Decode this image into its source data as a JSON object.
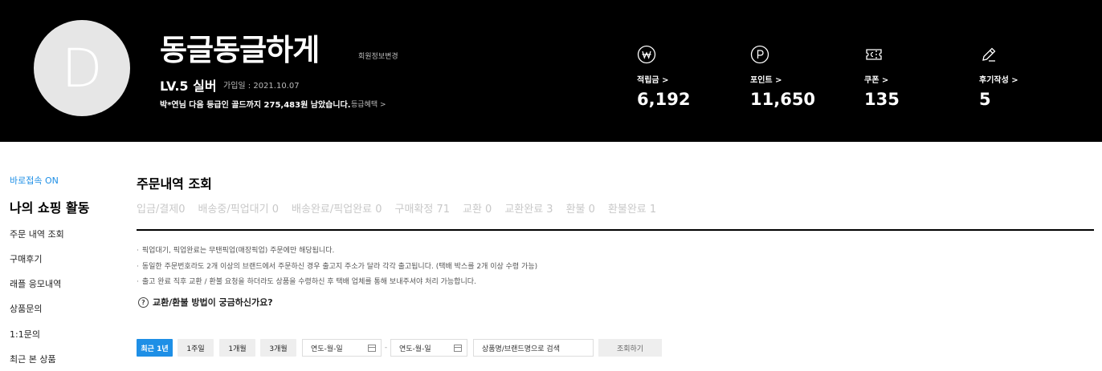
{
  "profile": {
    "avatar_letter": "D",
    "nickname": "동글동글하게",
    "edit_label": "회원정보변경",
    "level": "LV.5 실버",
    "join_date": "가입일 : 2021.10.07",
    "grade_message": "박*연님 다음 등급인 골드까지 275,483원 남았습니다.",
    "grade_benefit_link": "등급혜택 >"
  },
  "stats": [
    {
      "icon": "won-coin-icon",
      "label": "적립금 >",
      "value": "6,192"
    },
    {
      "icon": "point-coin-icon",
      "label": "포인트 >",
      "value": "11,650"
    },
    {
      "icon": "coupon-ticket-icon",
      "label": "쿠폰 >",
      "value": "135"
    },
    {
      "icon": "pencil-icon",
      "label": "후기작성 >",
      "value": "5"
    }
  ],
  "sidebar": {
    "quick_access": "바로접속 ON",
    "title": "나의 쇼핑 활동",
    "items": [
      "주문 내역 조회",
      "구매후기",
      "래플 응모내역",
      "상품문의",
      "1:1문의",
      "최근 본 상품"
    ]
  },
  "main": {
    "title": "주문내역 조회",
    "status_tabs": [
      "입금/결제0",
      "배송중/픽업대기 0",
      "배송완료/픽업완료 0",
      "구매확정 71",
      "교환 0",
      "교환완료 3",
      "환불 0",
      "환불완료 1"
    ],
    "notes": [
      "픽업대기, 픽업완료는 무탠픽업(매장픽업) 주문에만 해당됩니다.",
      "동일한 주문번호라도 2개 이상의 브랜드에서 주문하신 경우 출고지 주소가 달라 각각 출고됩니다. (택배 박스를 2개 이상 수령 가능)",
      "출고 완료 직후 교환 / 환불 요청을 하더라도 상품을 수령하신 후 택배 업체를 통해 보내주셔야 처리 가능합니다."
    ],
    "faq_icon": "question-circle-icon",
    "faq_text": "교환/환불 방법이 궁금하신가요?"
  },
  "filter": {
    "periods": [
      "최근 1년",
      "1주일",
      "1개월",
      "3개월"
    ],
    "start_date_placeholder": "연도-월-일",
    "date_separator": "-",
    "end_date_placeholder": "연도-월-일",
    "search_placeholder": "상품명/브랜드명으로 검색",
    "search_button": "조회하기"
  },
  "colors": {
    "header_bg": "#000000",
    "accent": "#1e8fe6"
  }
}
